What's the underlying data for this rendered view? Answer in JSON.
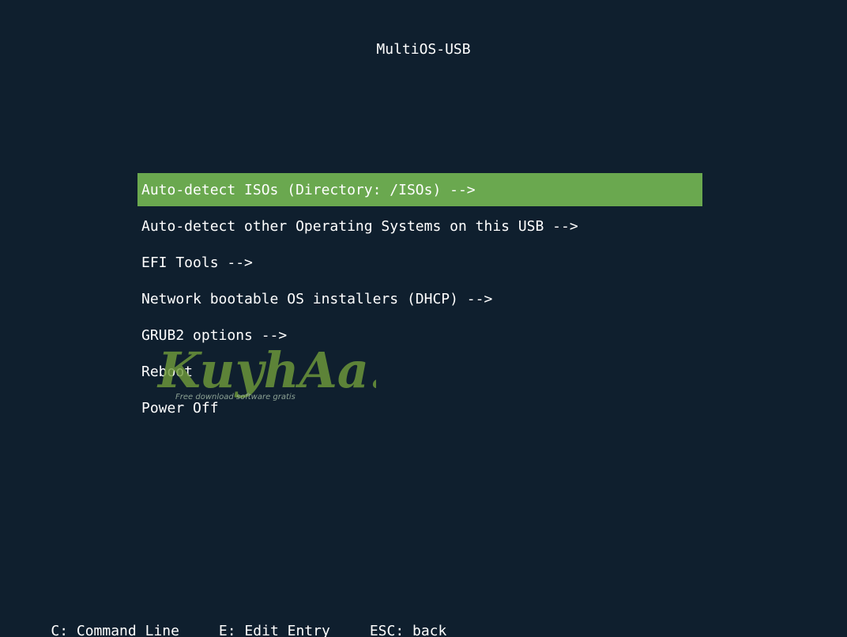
{
  "title": "MultiOS-USB",
  "menu": {
    "selected_index": 0,
    "items": [
      {
        "label": "Auto-detect ISOs (Directory: /ISOs) -->"
      },
      {
        "label": "Auto-detect other Operating Systems on this USB -->"
      },
      {
        "label": "EFI Tools -->"
      },
      {
        "label": "Network bootable OS installers (DHCP) -->"
      },
      {
        "label": "GRUB2 options -->"
      },
      {
        "label": "Reboot"
      },
      {
        "label": "Power Off"
      }
    ]
  },
  "footer": {
    "command_line": "C: Command Line",
    "edit_entry": "E: Edit Entry",
    "back": "ESC: back"
  },
  "watermark": {
    "brand": "KuyhAa.Me",
    "tagline": "Free download software gratis"
  },
  "colors": {
    "background": "#0f1f2e",
    "selection": "#6aa84f",
    "text": "#ffffff"
  }
}
